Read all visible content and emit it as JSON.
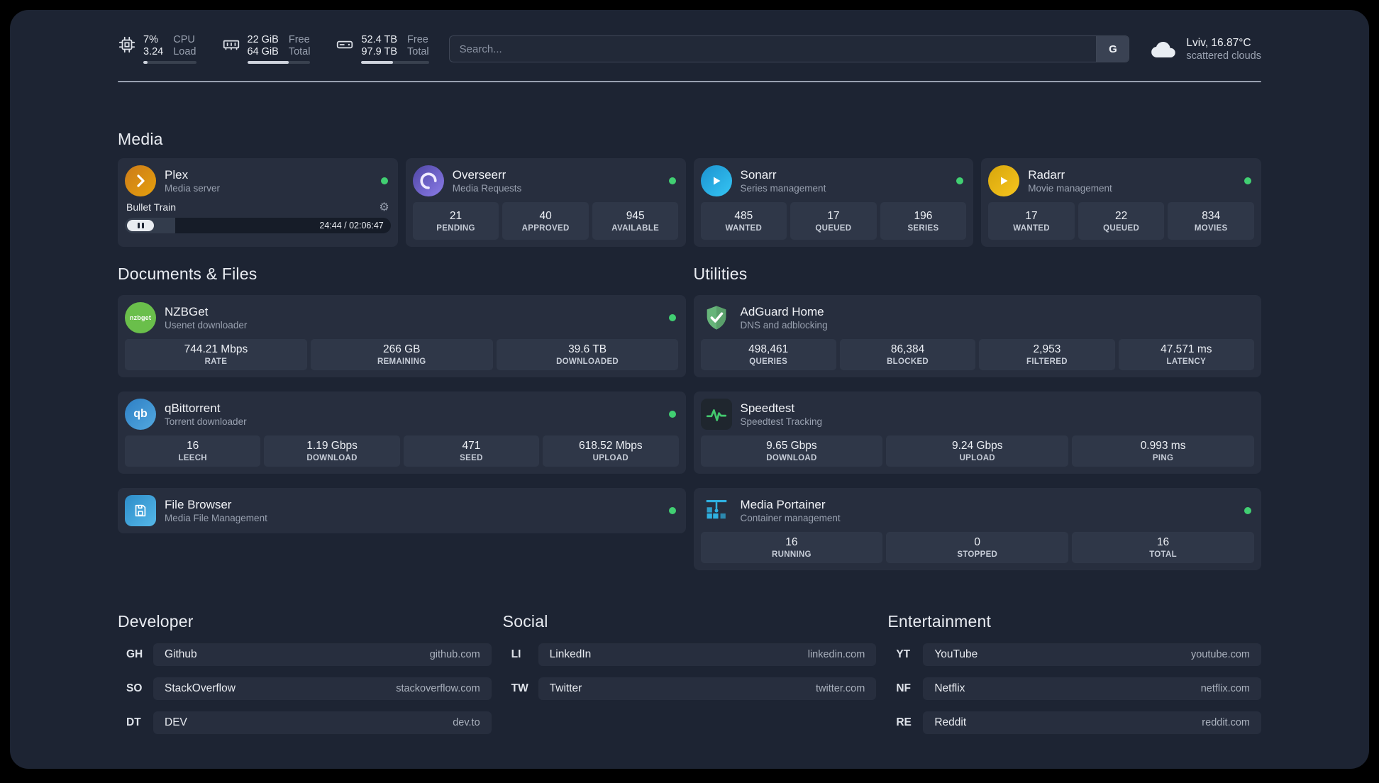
{
  "colors": {
    "status_green": "#41cf72"
  },
  "icons": {
    "gear": "⚙",
    "provider": "G"
  },
  "topbar": {
    "resources": [
      {
        "icon": "cpu-chip",
        "value1": "7%",
        "value2": "3.24",
        "label1": "CPU",
        "label2": "Load",
        "bar_percent": 8
      },
      {
        "icon": "memory-module",
        "value1": "22 GiB",
        "value2": "64 GiB",
        "label1": "Free",
        "label2": "Total",
        "bar_percent": 66
      },
      {
        "icon": "hard-drive",
        "value1": "52.4 TB",
        "value2": "97.9 TB",
        "label1": "Free",
        "label2": "Total",
        "bar_percent": 47
      }
    ],
    "search": {
      "placeholder": "Search...",
      "provider_label": "G"
    },
    "weather": {
      "location": "Lviv, 16.87°C",
      "condition": "scattered clouds"
    }
  },
  "section_titles": {
    "media": "Media",
    "documents": "Documents & Files",
    "utilities": "Utilities",
    "developer": "Developer",
    "social": "Social",
    "entertainment": "Entertainment"
  },
  "services": {
    "plex": {
      "name": "Plex",
      "description": "Media server",
      "now_playing": "Bullet Train",
      "elapsed_total": "24:44 / 02:06:47",
      "progress_percent": 19
    },
    "overseerr": {
      "name": "Overseerr",
      "description": "Media Requests",
      "stats": [
        {
          "value": "21",
          "label": "PENDING"
        },
        {
          "value": "40",
          "label": "APPROVED"
        },
        {
          "value": "945",
          "label": "AVAILABLE"
        }
      ]
    },
    "sonarr": {
      "name": "Sonarr",
      "description": "Series management",
      "stats": [
        {
          "value": "485",
          "label": "WANTED"
        },
        {
          "value": "17",
          "label": "QUEUED"
        },
        {
          "value": "196",
          "label": "SERIES"
        }
      ]
    },
    "radarr": {
      "name": "Radarr",
      "description": "Movie management",
      "stats": [
        {
          "value": "17",
          "label": "WANTED"
        },
        {
          "value": "22",
          "label": "QUEUED"
        },
        {
          "value": "834",
          "label": "MOVIES"
        }
      ]
    },
    "nzbget": {
      "name": "NZBGet",
      "description": "Usenet downloader",
      "icon_text": "nzbget",
      "stats": [
        {
          "value": "744.21 Mbps",
          "label": "RATE"
        },
        {
          "value": "266 GB",
          "label": "REMAINING"
        },
        {
          "value": "39.6 TB",
          "label": "DOWNLOADED"
        }
      ]
    },
    "qbittorrent": {
      "name": "qBittorrent",
      "description": "Torrent downloader",
      "icon_text": "qb",
      "stats": [
        {
          "value": "16",
          "label": "LEECH"
        },
        {
          "value": "1.19 Gbps",
          "label": "DOWNLOAD"
        },
        {
          "value": "471",
          "label": "SEED"
        },
        {
          "value": "618.52 Mbps",
          "label": "UPLOAD"
        }
      ]
    },
    "filebrowser": {
      "name": "File Browser",
      "description": "Media File Management"
    },
    "adguard": {
      "name": "AdGuard Home",
      "description": "DNS and adblocking",
      "stats": [
        {
          "value": "498,461",
          "label": "QUERIES"
        },
        {
          "value": "86,384",
          "label": "BLOCKED"
        },
        {
          "value": "2,953",
          "label": "FILTERED"
        },
        {
          "value": "47.571 ms",
          "label": "LATENCY"
        }
      ]
    },
    "speedtest": {
      "name": "Speedtest",
      "description": "Speedtest Tracking",
      "stats": [
        {
          "value": "9.65 Gbps",
          "label": "DOWNLOAD"
        },
        {
          "value": "9.24 Gbps",
          "label": "UPLOAD"
        },
        {
          "value": "0.993 ms",
          "label": "PING"
        }
      ]
    },
    "portainer": {
      "name": "Media Portainer",
      "description": "Container management",
      "stats": [
        {
          "value": "16",
          "label": "RUNNING"
        },
        {
          "value": "0",
          "label": "STOPPED"
        },
        {
          "value": "16",
          "label": "TOTAL"
        }
      ]
    }
  },
  "bookmarks": {
    "developer": [
      {
        "abbr": "GH",
        "name": "Github",
        "domain": "github.com"
      },
      {
        "abbr": "SO",
        "name": "StackOverflow",
        "domain": "stackoverflow.com"
      },
      {
        "abbr": "DT",
        "name": "DEV",
        "domain": "dev.to"
      }
    ],
    "social": [
      {
        "abbr": "LI",
        "name": "LinkedIn",
        "domain": "linkedin.com"
      },
      {
        "abbr": "TW",
        "name": "Twitter",
        "domain": "twitter.com"
      }
    ],
    "entertainment": [
      {
        "abbr": "YT",
        "name": "YouTube",
        "domain": "youtube.com"
      },
      {
        "abbr": "NF",
        "name": "Netflix",
        "domain": "netflix.com"
      },
      {
        "abbr": "RE",
        "name": "Reddit",
        "domain": "reddit.com"
      }
    ]
  }
}
